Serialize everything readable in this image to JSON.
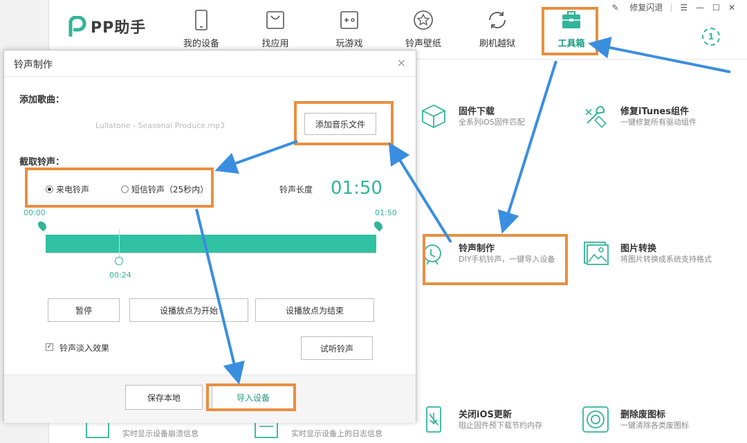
{
  "app": {
    "logo_text": "PP助手",
    "nav": [
      {
        "label": "我的设备",
        "icon": "phone-icon"
      },
      {
        "label": "找应用",
        "icon": "app-bag-icon"
      },
      {
        "label": "玩游戏",
        "icon": "gamepad-icon"
      },
      {
        "label": "铃声壁纸",
        "icon": "star-icon"
      },
      {
        "label": "刷机越狱",
        "icon": "refresh-icon"
      },
      {
        "label": "工具箱",
        "icon": "toolbox-icon"
      }
    ],
    "window": {
      "repair": "修复闪退",
      "menu": "☰",
      "minimize": "—",
      "maximize": "☐",
      "close": "✕"
    },
    "badge": "1"
  },
  "tools": [
    {
      "title": "固件下载",
      "desc": "全系列iOS固件匹配",
      "icon": "cube-icon"
    },
    {
      "title": "修复iTunes组件",
      "desc": "一键修复所有驱动组件",
      "icon": "wrench-icon"
    },
    {
      "title": "铃声制作",
      "desc": "DIY手机铃声，一键导入设备",
      "icon": "bell-icon"
    },
    {
      "title": "图片转换",
      "desc": "将图片转换成系统支持格式",
      "icon": "image-icon"
    },
    {
      "title": "",
      "desc": "实时显示设备崩溃信息",
      "icon": "crash-log-icon"
    },
    {
      "title": "",
      "desc": "实时显示设备上的日志信息",
      "icon": "log-icon"
    },
    {
      "title": "关闭iOS更新",
      "desc": "阻止固件预下载节约内存",
      "icon": "no-update-icon"
    },
    {
      "title": "删除废图标",
      "desc": "一键清除各类废图标",
      "icon": "delete-icon"
    }
  ],
  "dialog": {
    "title": "铃声制作",
    "close": "×",
    "add_song_label": "添加歌曲：",
    "song_name": "Lullatone - Seasonal Produce.mp3",
    "add_music_btn": "添加音乐文件",
    "cut_label": "截取铃声：",
    "radio_call": "来电铃声",
    "radio_sms": "短信铃声（25秒内）",
    "length_label": "铃声长度",
    "length_value": "01:50",
    "start_time": "00:00",
    "end_time": "01:50",
    "play_time": "00:24",
    "play_position": 0.218,
    "pause_btn": "暂停",
    "set_start_btn": "设播放点为开始",
    "set_end_btn": "设播放点为结束",
    "fade_check": "✓",
    "fade_label": "铃声淡入效果",
    "preview_btn": "试听铃声",
    "save_btn": "保存本地",
    "import_btn": "导入设备"
  },
  "colors": {
    "accent": "#31b59a",
    "highlight": "#e88f3f",
    "arrow": "#3a8ee0"
  }
}
